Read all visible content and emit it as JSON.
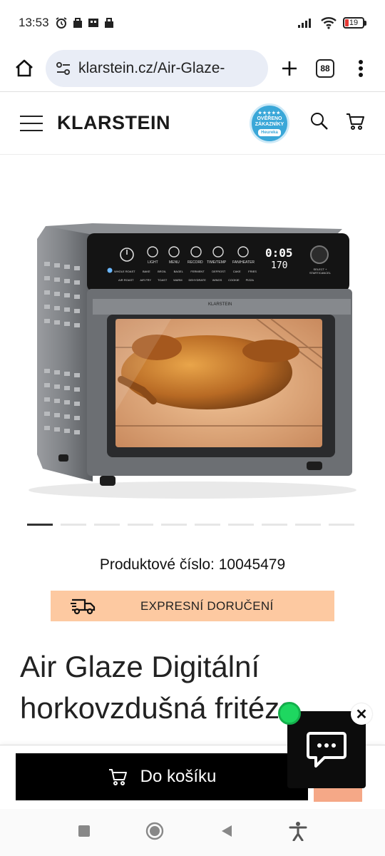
{
  "status_bar": {
    "time": "13:53",
    "battery": "19"
  },
  "browser": {
    "url": "klarstein.cz/Air-Glaze-",
    "tab_count": "88"
  },
  "header": {
    "logo": "KLARSTEIN",
    "badge_line1": "OVĚŘENO",
    "badge_line2": "ZÁKAZNÍKY",
    "badge_brand": "Heureka"
  },
  "gallery": {
    "slide_count": 10,
    "active_slide": 1,
    "oven": {
      "buttons": [
        "LIGHT",
        "MENU",
        "RECORD",
        "TIME/TEMP",
        "FAN/HEATER"
      ],
      "display_time": "0:05",
      "display_temp": "170",
      "knob_label": "SELECT + START/CANCEL",
      "modes_row1": [
        "WHOLE ROAST",
        "BAKE",
        "BROIL",
        "BAGEL",
        "FERMENT",
        "DEFROST",
        "CAKE",
        "FRIES"
      ],
      "modes_row2": [
        "AIR ROAST",
        "AIR FRY",
        "TOAST",
        "WARM",
        "DEHYDRATE",
        "WINGS",
        "COOKIE",
        "PIZZA"
      ],
      "door_brand": "KLARSTEIN"
    }
  },
  "product": {
    "number_label": "Produktové číslo: 10045479",
    "express_label": "EXPRESNÍ DORUČENÍ",
    "title": "Air Glaze Digitální horkovzdušná fritéza"
  },
  "actions": {
    "add_to_cart": "Do košíku",
    "chat_close": "✕"
  }
}
